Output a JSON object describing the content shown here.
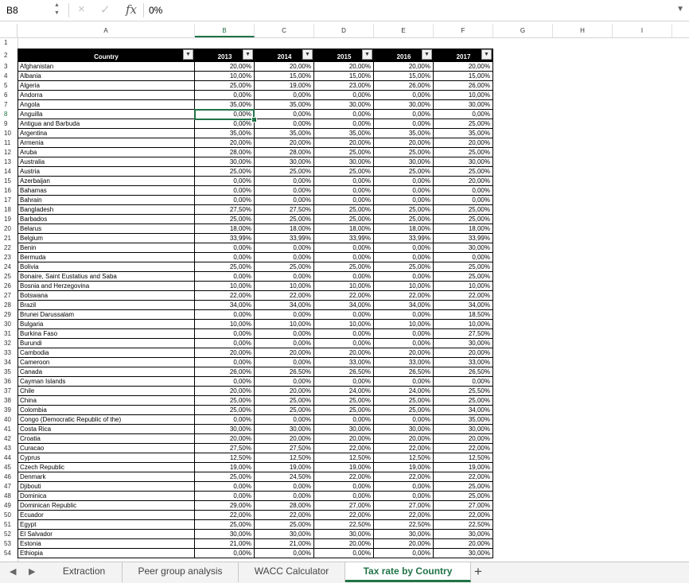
{
  "formula_bar": {
    "cell_ref": "B8",
    "cancel_icon": "×",
    "enter_icon": "✓",
    "fx_label": "fx",
    "value": "0%"
  },
  "columns": [
    "A",
    "B",
    "C",
    "D",
    "E",
    "F",
    "G",
    "H",
    "I"
  ],
  "selected_cell": {
    "column": "B",
    "row": 8
  },
  "table": {
    "headers": [
      "Country",
      "2013",
      "2014",
      "2015",
      "2016",
      "2017"
    ],
    "rows": [
      [
        "Afghanistan",
        "20,00%",
        "20,00%",
        "20,00%",
        "20,00%",
        "20,00%"
      ],
      [
        "Albania",
        "10,00%",
        "15,00%",
        "15,00%",
        "15,00%",
        "15,00%"
      ],
      [
        "Algeria",
        "25,00%",
        "19,00%",
        "23,00%",
        "26,00%",
        "26,00%"
      ],
      [
        "Andorra",
        "0,00%",
        "0,00%",
        "0,00%",
        "0,00%",
        "10,00%"
      ],
      [
        "Angola",
        "35,00%",
        "35,00%",
        "30,00%",
        "30,00%",
        "30,00%"
      ],
      [
        "Anguilla",
        "0,00%",
        "0,00%",
        "0,00%",
        "0,00%",
        "0,00%"
      ],
      [
        "Antigua and Barbuda",
        "0,00%",
        "0,00%",
        "0,00%",
        "0,00%",
        "25,00%"
      ],
      [
        "Argentina",
        "35,00%",
        "35,00%",
        "35,00%",
        "35,00%",
        "35,00%"
      ],
      [
        "Armenia",
        "20,00%",
        "20,00%",
        "20,00%",
        "20,00%",
        "20,00%"
      ],
      [
        "Aruba",
        "28,00%",
        "28,00%",
        "25,00%",
        "25,00%",
        "25,00%"
      ],
      [
        "Australia",
        "30,00%",
        "30,00%",
        "30,00%",
        "30,00%",
        "30,00%"
      ],
      [
        "Austria",
        "25,00%",
        "25,00%",
        "25,00%",
        "25,00%",
        "25,00%"
      ],
      [
        "Azerbaijan",
        "0,00%",
        "0,00%",
        "0,00%",
        "0,00%",
        "20,00%"
      ],
      [
        "Bahamas",
        "0,00%",
        "0,00%",
        "0,00%",
        "0,00%",
        "0,00%"
      ],
      [
        "Bahrain",
        "0,00%",
        "0,00%",
        "0,00%",
        "0,00%",
        "0,00%"
      ],
      [
        "Bangladesh",
        "27,50%",
        "27,50%",
        "25,00%",
        "25,00%",
        "25,00%"
      ],
      [
        "Barbados",
        "25,00%",
        "25,00%",
        "25,00%",
        "25,00%",
        "25,00%"
      ],
      [
        "Belarus",
        "18,00%",
        "18,00%",
        "18,00%",
        "18,00%",
        "18,00%"
      ],
      [
        "Belgium",
        "33,99%",
        "33,99%",
        "33,99%",
        "33,99%",
        "33,99%"
      ],
      [
        "Benin",
        "0,00%",
        "0,00%",
        "0,00%",
        "0,00%",
        "30,00%"
      ],
      [
        "Bermuda",
        "0,00%",
        "0,00%",
        "0,00%",
        "0,00%",
        "0,00%"
      ],
      [
        "Bolivia",
        "25,00%",
        "25,00%",
        "25,00%",
        "25,00%",
        "25,00%"
      ],
      [
        "Bonaire, Saint Eustatius and Saba",
        "0,00%",
        "0,00%",
        "0,00%",
        "0,00%",
        "25,00%"
      ],
      [
        "Bosnia and Herzegovina",
        "10,00%",
        "10,00%",
        "10,00%",
        "10,00%",
        "10,00%"
      ],
      [
        "Botswana",
        "22,00%",
        "22,00%",
        "22,00%",
        "22,00%",
        "22,00%"
      ],
      [
        "Brazil",
        "34,00%",
        "34,00%",
        "34,00%",
        "34,00%",
        "34,00%"
      ],
      [
        "Brunei Darussalam",
        "0,00%",
        "0,00%",
        "0,00%",
        "0,00%",
        "18,50%"
      ],
      [
        "Bulgaria",
        "10,00%",
        "10,00%",
        "10,00%",
        "10,00%",
        "10,00%"
      ],
      [
        "Burkina Faso",
        "0,00%",
        "0,00%",
        "0,00%",
        "0,00%",
        "27,50%"
      ],
      [
        "Burundi",
        "0,00%",
        "0,00%",
        "0,00%",
        "0,00%",
        "30,00%"
      ],
      [
        "Cambodia",
        "20,00%",
        "20,00%",
        "20,00%",
        "20,00%",
        "20,00%"
      ],
      [
        "Cameroon",
        "0,00%",
        "0,00%",
        "33,00%",
        "33,00%",
        "33,00%"
      ],
      [
        "Canada",
        "26,00%",
        "26,50%",
        "26,50%",
        "26,50%",
        "26,50%"
      ],
      [
        "Cayman Islands",
        "0,00%",
        "0,00%",
        "0,00%",
        "0,00%",
        "0,00%"
      ],
      [
        "Chile",
        "20,00%",
        "20,00%",
        "24,00%",
        "24,00%",
        "25,50%"
      ],
      [
        "China",
        "25,00%",
        "25,00%",
        "25,00%",
        "25,00%",
        "25,00%"
      ],
      [
        "Colombia",
        "25,00%",
        "25,00%",
        "25,00%",
        "25,00%",
        "34,00%"
      ],
      [
        "Congo (Democratic Republic of the)",
        "0,00%",
        "0,00%",
        "0,00%",
        "0,00%",
        "35,00%"
      ],
      [
        "Costa Rica",
        "30,00%",
        "30,00%",
        "30,00%",
        "30,00%",
        "30,00%"
      ],
      [
        "Croatia",
        "20,00%",
        "20,00%",
        "20,00%",
        "20,00%",
        "20,00%"
      ],
      [
        "Curacao",
        "27,50%",
        "27,50%",
        "22,00%",
        "22,00%",
        "22,00%"
      ],
      [
        "Cyprus",
        "12,50%",
        "12,50%",
        "12,50%",
        "12,50%",
        "12,50%"
      ],
      [
        "Czech Republic",
        "19,00%",
        "19,00%",
        "19,00%",
        "19,00%",
        "19,00%"
      ],
      [
        "Denmark",
        "25,00%",
        "24,50%",
        "22,00%",
        "22,00%",
        "22,00%"
      ],
      [
        "Djibouti",
        "0,00%",
        "0,00%",
        "0,00%",
        "0,00%",
        "25,00%"
      ],
      [
        "Dominica",
        "0,00%",
        "0,00%",
        "0,00%",
        "0,00%",
        "25,00%"
      ],
      [
        "Dominican Republic",
        "29,00%",
        "28,00%",
        "27,00%",
        "27,00%",
        "27,00%"
      ],
      [
        "Ecuador",
        "22,00%",
        "22,00%",
        "22,00%",
        "22,00%",
        "22,00%"
      ],
      [
        "Egypt",
        "25,00%",
        "25,00%",
        "22,50%",
        "22,50%",
        "22,50%"
      ],
      [
        "El Salvador",
        "30,00%",
        "30,00%",
        "30,00%",
        "30,00%",
        "30,00%"
      ],
      [
        "Estonia",
        "21,00%",
        "21,00%",
        "20,00%",
        "20,00%",
        "20,00%"
      ],
      [
        "Ethiopia",
        "0,00%",
        "0,00%",
        "0,00%",
        "0,00%",
        "30,00%"
      ]
    ]
  },
  "sheet_tabs": [
    "Extraction",
    "Peer group analysis",
    "WACC Calculator",
    "Tax rate by Country"
  ],
  "active_tab": "Tax rate by Country",
  "add_sheet_label": "+",
  "icons": {
    "namebox": "stepper-arrows-icon",
    "cancel": "cancel-x-icon",
    "enter": "checkmark-icon",
    "fx": "function-icon",
    "filter": "dropdown-filter-icon",
    "prev": "prev-sheet-icon",
    "next": "next-sheet-icon"
  },
  "colors": {
    "accent": "#217346",
    "header_fill": "#000000",
    "header_text": "#ffffff"
  }
}
